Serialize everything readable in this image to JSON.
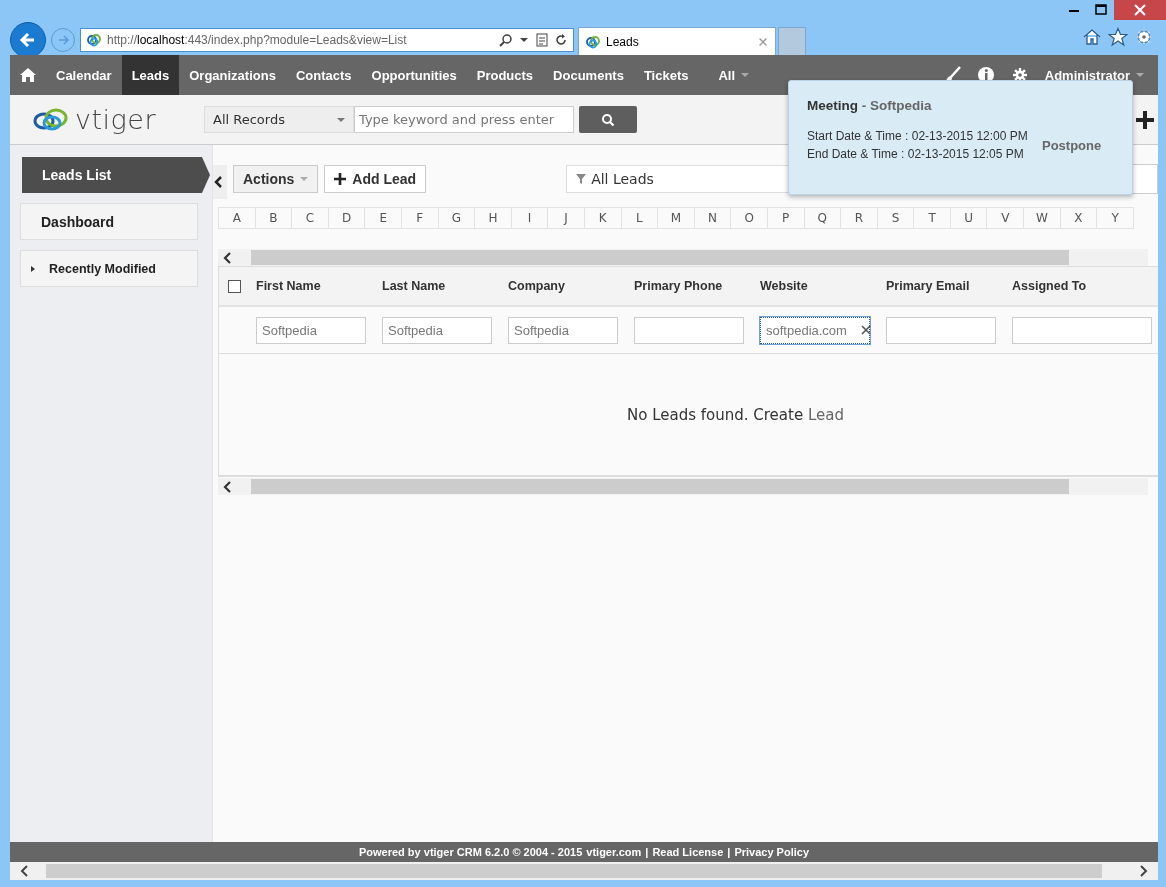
{
  "browser": {
    "url": {
      "scheme": "http://",
      "host": "localhost",
      "rest": ":443/index.php?module=Leads&view=List"
    },
    "tabs": [
      {
        "title": "Leads",
        "selected": true
      }
    ]
  },
  "nav": {
    "items": [
      {
        "label": "Calendar",
        "selected": false
      },
      {
        "label": "Leads",
        "selected": true
      },
      {
        "label": "Organizations",
        "selected": false
      },
      {
        "label": "Contacts",
        "selected": false
      },
      {
        "label": "Opportunities",
        "selected": false
      },
      {
        "label": "Products",
        "selected": false
      },
      {
        "label": "Documents",
        "selected": false
      },
      {
        "label": "Tickets",
        "selected": false
      }
    ],
    "more": "All",
    "user": "Administrator"
  },
  "header": {
    "logo": "vtiger",
    "search_scope": "All Records",
    "search": {
      "placeholder": "Type keyword and press enter"
    }
  },
  "sidebar": {
    "items": [
      {
        "label": "Leads List",
        "selected": true,
        "kind": "link"
      },
      {
        "label": "Dashboard",
        "selected": false,
        "kind": "link"
      },
      {
        "label": "Recently Modified",
        "selected": false,
        "kind": "collapsible"
      }
    ]
  },
  "toolbar": {
    "actions": "Actions",
    "add": "Add Lead",
    "filter": "All Leads"
  },
  "alphabet": [
    "A",
    "B",
    "C",
    "D",
    "E",
    "F",
    "G",
    "H",
    "I",
    "J",
    "K",
    "L",
    "M",
    "N",
    "O",
    "P",
    "Q",
    "R",
    "S",
    "T",
    "U",
    "V",
    "W",
    "X",
    "Y"
  ],
  "table": {
    "columns": [
      {
        "label": "First Name",
        "filter_value": "Softpedia",
        "focused": false
      },
      {
        "label": "Last Name",
        "filter_value": "Softpedia",
        "focused": false
      },
      {
        "label": "Company",
        "filter_value": "Softpedia",
        "focused": false
      },
      {
        "label": "Primary Phone",
        "focused": false
      },
      {
        "label": "Website",
        "filter_value": "softpedia.com",
        "focused": true
      },
      {
        "label": "Primary Email",
        "focused": false
      },
      {
        "label": "Assigned To",
        "focused": false
      }
    ],
    "select_all_checked": false,
    "empty_message": "No Leads found. Create ",
    "empty_link": "Lead"
  },
  "reminder": {
    "title": "Meeting",
    "subject": " - Softpedia",
    "start": "Start Date & Time : 02-13-2015 12:00 PM",
    "end": "End Date & Time : 02-13-2015 12:05 PM",
    "action": "Postpone"
  },
  "footer": {
    "text": "Powered by vtiger CRM 6.2.0  © 2004 - 2015 ",
    "links": [
      "vtiger.com",
      "Read License",
      "Privacy Policy"
    ],
    "separator": "|"
  }
}
